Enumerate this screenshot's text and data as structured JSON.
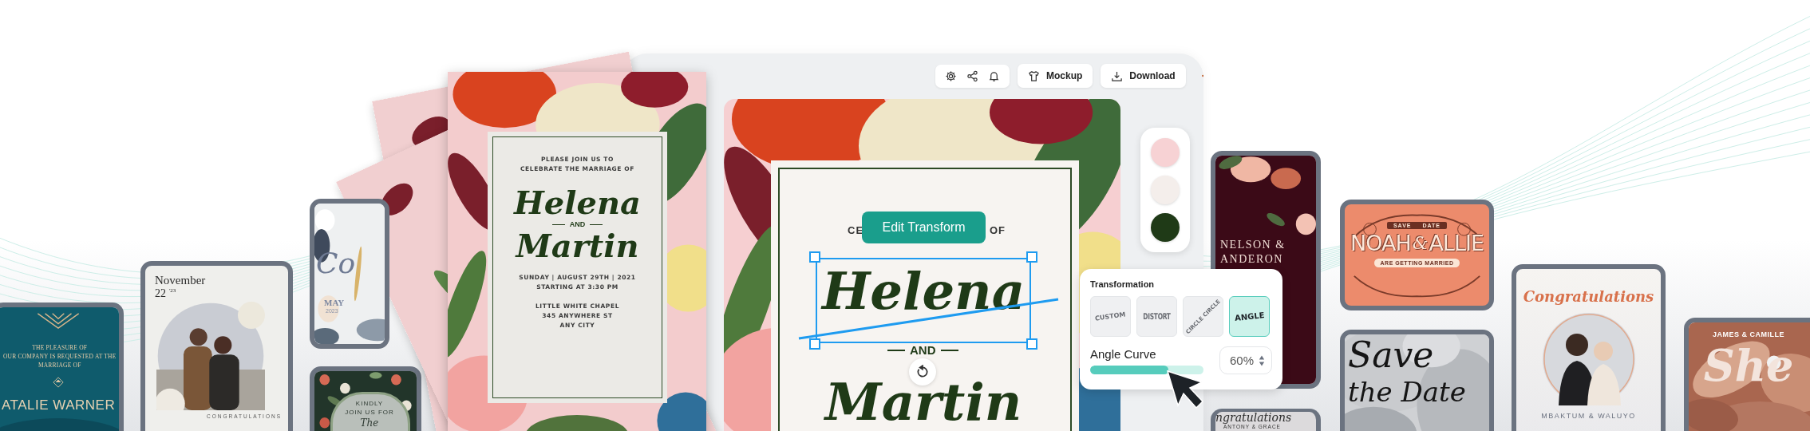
{
  "toolbar": {
    "buttons": [
      {
        "kind": "mockup",
        "label": "Mockup"
      },
      {
        "kind": "download",
        "label": "Download"
      }
    ]
  },
  "palette": [
    {
      "color": "#f7d2d4"
    },
    {
      "color": "#f4eeeb"
    },
    {
      "color": "#1f3a17"
    }
  ],
  "canvas": {
    "fragments": [
      "CE",
      "OF"
    ],
    "edit_button": "Edit Transform",
    "names": [
      "Helena",
      "Martin"
    ],
    "conjunction": "AND"
  },
  "transformation": {
    "title": "Transformation",
    "options": [
      {
        "kind": "arc",
        "label": "CUSTOM",
        "selected": false
      },
      {
        "kind": "distort",
        "label": "DISTORT",
        "selected": false
      },
      {
        "kind": "circle",
        "label": "CIRCLE CIRCLE",
        "selected": false
      },
      {
        "kind": "angle",
        "label": "ANGLE",
        "selected": true
      }
    ],
    "slider": {
      "label": "Angle Curve",
      "level": 0.69
    },
    "value": "60%"
  },
  "featured_card": {
    "intro": [
      "PLEASE JOIN US TO",
      "CELEBRATE THE MARRIAGE OF"
    ],
    "names": [
      "Helena",
      "Martin"
    ],
    "conjunction": "AND",
    "details": [
      "SUNDAY | AUGUST 29TH | 2021",
      "STARTING AT 3:30 PM"
    ],
    "venue": [
      "LITTLE WHITE CHAPEL",
      "345 ANYWHERE ST",
      "ANY CITY"
    ]
  },
  "gallery": [
    {
      "kind": "deco",
      "lines": [
        "THE PLEASURE OF",
        "OUR COMPANY IS REQUESTED AT THE",
        "MARRIAGE OF"
      ],
      "name": "ATALIE WARNER"
    },
    {
      "kind": "photo-date",
      "month": "November",
      "day": "22",
      "year": "'23",
      "caption": "CONGRATULATIONS"
    },
    {
      "kind": "watercolor",
      "script": "Co",
      "month": "MAY",
      "year": "2023"
    },
    {
      "kind": "tapestry",
      "lines": [
        "KINDLY",
        "JOIN US FOR"
      ],
      "script": "The"
    },
    {
      "kind": "burgundy",
      "lines": [
        "NELSON &",
        "ANDERON"
      ]
    },
    {
      "kind": "burgundy-congrats",
      "script": "ngratulations",
      "names": "ANTONY & GRACE"
    },
    {
      "kind": "vintage",
      "ribbon_top": [
        "SAVE",
        "DATE"
      ],
      "names": [
        "NOAH",
        "&",
        "ALLIE"
      ],
      "ribbon": "ARE GETTING MARRIED"
    },
    {
      "kind": "save-date",
      "script": [
        "Save",
        "the Date"
      ]
    },
    {
      "kind": "portrait",
      "title": "Congratulations",
      "names": "MBAKTUM & WALUYO"
    },
    {
      "kind": "ring",
      "names": "JAMES & CAMILLE",
      "script": "She"
    }
  ]
}
